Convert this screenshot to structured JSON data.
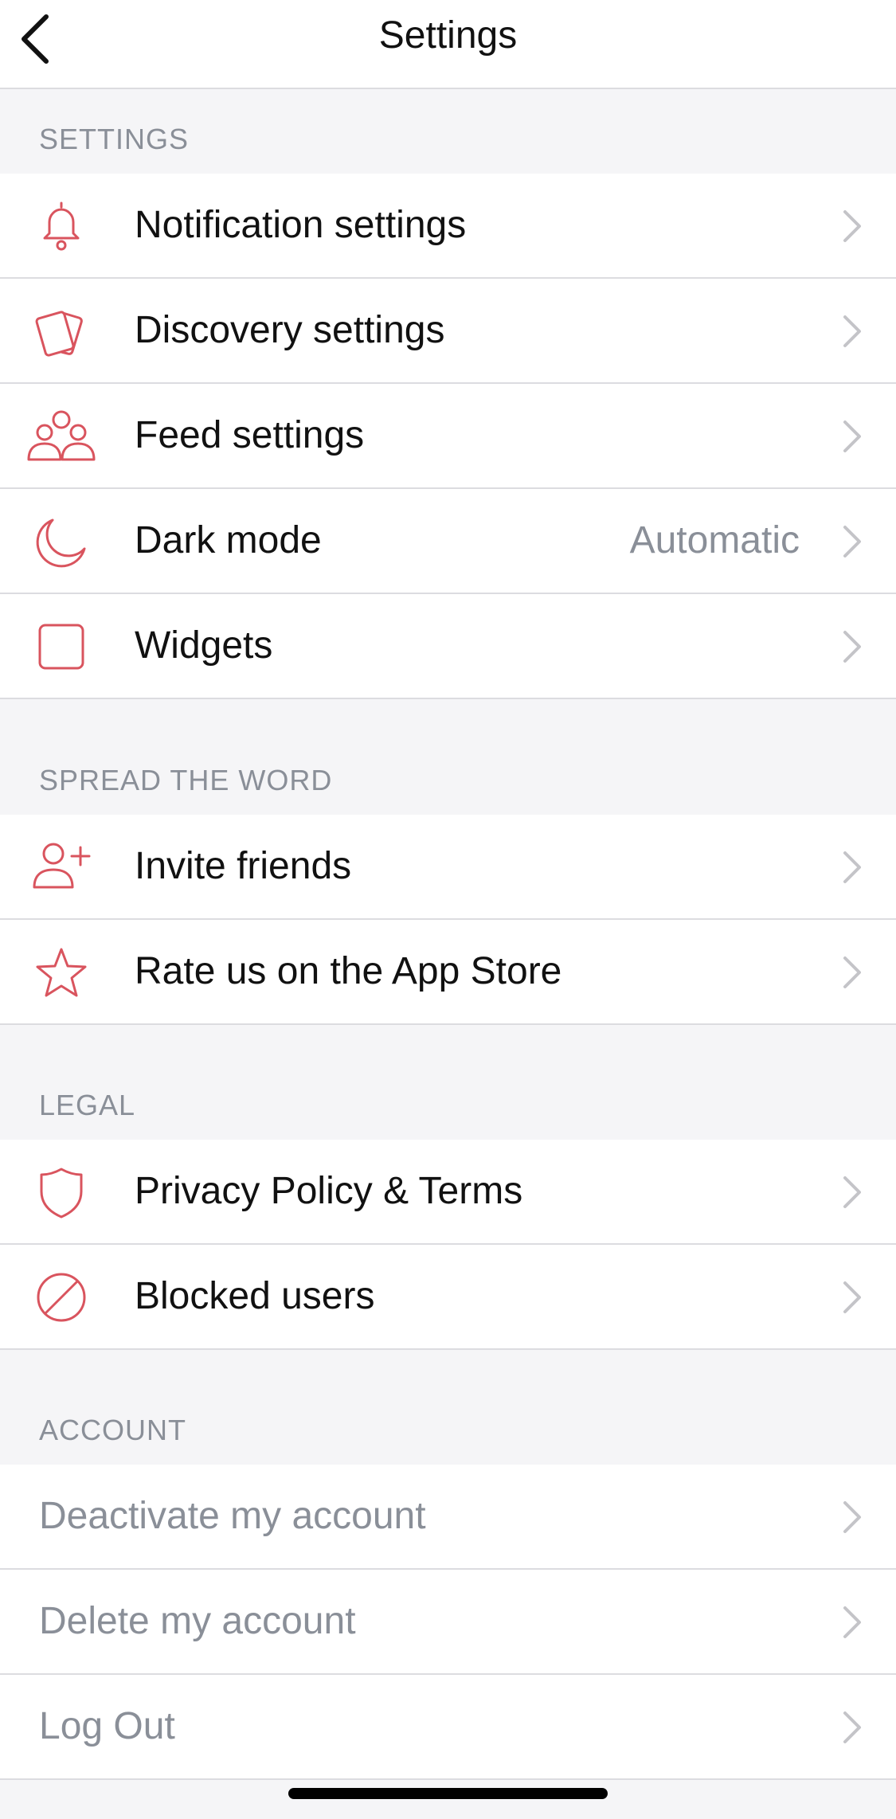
{
  "header": {
    "title": "Settings",
    "back_icon": "chevron-left-icon"
  },
  "sections": {
    "settings": {
      "title": "SETTINGS",
      "items": [
        {
          "label": "Notification settings",
          "icon": "bell-icon"
        },
        {
          "label": "Discovery settings",
          "icon": "cards-icon"
        },
        {
          "label": "Feed settings",
          "icon": "people-group-icon"
        },
        {
          "label": "Dark mode",
          "value": "Automatic",
          "icon": "moon-icon"
        },
        {
          "label": "Widgets",
          "icon": "square-icon"
        }
      ]
    },
    "spread": {
      "title": "SPREAD THE WORD",
      "items": [
        {
          "label": "Invite friends",
          "icon": "person-add-icon"
        },
        {
          "label": "Rate us on the App Store",
          "icon": "star-icon"
        }
      ]
    },
    "legal": {
      "title": "LEGAL",
      "items": [
        {
          "label": "Privacy Policy & Terms",
          "icon": "shield-icon"
        },
        {
          "label": "Blocked users",
          "icon": "block-icon"
        }
      ]
    },
    "account": {
      "title": "ACCOUNT",
      "items": [
        {
          "label": "Deactivate my account"
        },
        {
          "label": "Delete my account"
        },
        {
          "label": "Log Out"
        }
      ]
    }
  },
  "colors": {
    "accent": "#d9545e",
    "muted_text": "#8a8f98",
    "chevron": "#c4c4c8",
    "grouped_background": "#f5f5f7"
  }
}
